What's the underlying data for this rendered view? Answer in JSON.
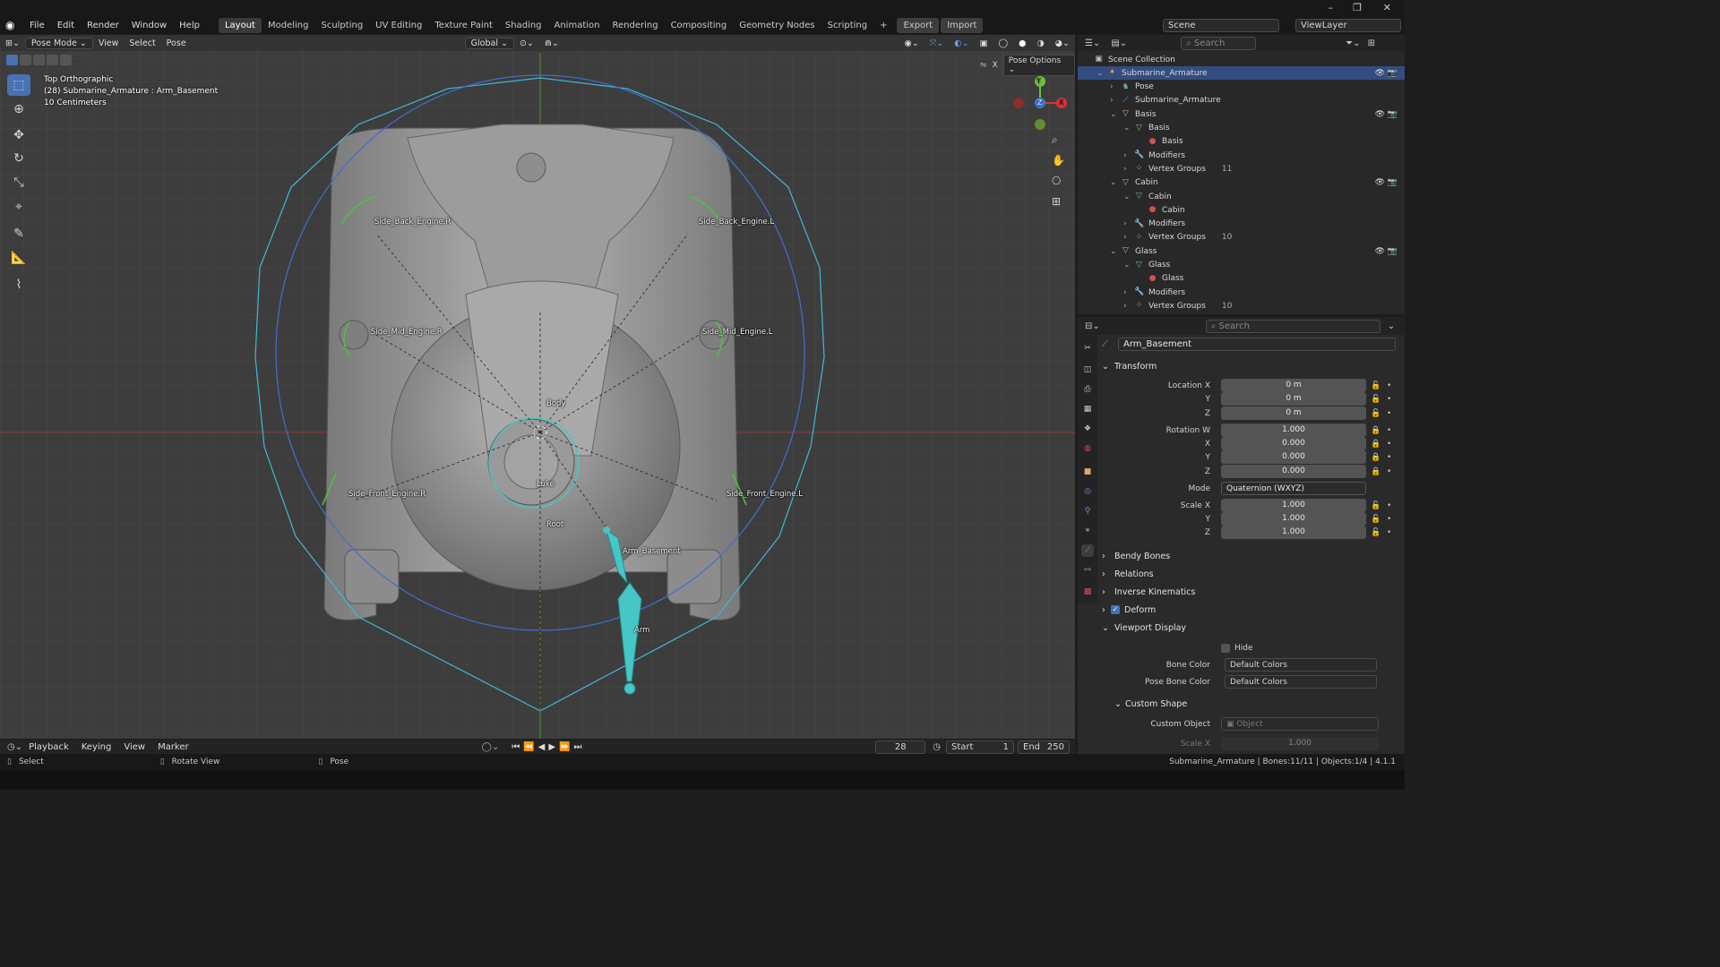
{
  "topbar": {
    "minimize": "–",
    "maximize": "❐",
    "close": "✕"
  },
  "menubar": {
    "menus": [
      "File",
      "Edit",
      "Render",
      "Window",
      "Help"
    ],
    "workspaces": [
      "Layout",
      "Modeling",
      "Sculpting",
      "UV Editing",
      "Texture Paint",
      "Shading",
      "Animation",
      "Rendering",
      "Compositing",
      "Geometry Nodes",
      "Scripting"
    ],
    "active_workspace": "Layout",
    "add_ws": "+",
    "export": "Export",
    "import": "Import",
    "scene": "Scene",
    "view_layer": "ViewLayer"
  },
  "viewport_header": {
    "mode": "Pose Mode",
    "menus": [
      "View",
      "Select",
      "Pose"
    ],
    "orientation": "Global",
    "pose_options": "Pose Options",
    "x_label": "X"
  },
  "viewport": {
    "view_name": "Top Orthographic",
    "object_info": "(28) Submarine_Armature : Arm_Basement",
    "scale_info": "10 Centimeters",
    "gizmo": {
      "y": "Y",
      "z": "Z",
      "x": "X"
    },
    "bones": [
      "Side_Back_Engine.R",
      "Side_Back_Engine.L",
      "Side_Mid_Engine.R",
      "Side_Mid_Engine.L",
      "Body",
      "Luke",
      "Side_Front_Engine.R",
      "Side_Front_Engine.L",
      "Root",
      "Arm_Basement",
      "Arm"
    ]
  },
  "outliner": {
    "search_placeholder": "Search",
    "rows": [
      {
        "label": "Scene Collection",
        "indent": 0,
        "icon": "collection-icon",
        "color": "#bdbdbd"
      },
      {
        "label": "Submarine_Armature",
        "indent": 1,
        "icon": "armature-icon",
        "color": "#e1a46b",
        "selected": true,
        "eye": true
      },
      {
        "label": "Pose",
        "indent": 2,
        "icon": "pose-icon",
        "color": "#6ea9a0"
      },
      {
        "label": "Submarine_Armature",
        "indent": 2,
        "icon": "armature-data-icon",
        "color": "#6ea9a0"
      },
      {
        "label": "Basis",
        "indent": 2,
        "icon": "mesh-object-icon",
        "color": "#e1a46b",
        "eye": true
      },
      {
        "label": "Basis",
        "indent": 3,
        "icon": "mesh-data-icon",
        "color": "#6ec17e"
      },
      {
        "label": "Basis",
        "indent": 4,
        "icon": "material-icon",
        "color": "#d05050"
      },
      {
        "label": "Modifiers",
        "indent": 3,
        "icon": "wrench-icon",
        "color": "#6c8fd3"
      },
      {
        "label": "Vertex Groups",
        "indent": 3,
        "icon": "vertex-groups-icon",
        "color": "#cfcfcf"
      },
      {
        "label": "Cabin",
        "indent": 2,
        "icon": "mesh-object-icon",
        "color": "#e1a46b",
        "eye": true
      },
      {
        "label": "Cabin",
        "indent": 3,
        "icon": "mesh-data-icon",
        "color": "#6ec17e"
      },
      {
        "label": "Cabin",
        "indent": 4,
        "icon": "material-icon",
        "color": "#d05050"
      },
      {
        "label": "Modifiers",
        "indent": 3,
        "icon": "wrench-icon",
        "color": "#6c8fd3"
      },
      {
        "label": "Vertex Groups",
        "indent": 3,
        "icon": "vertex-groups-icon",
        "color": "#cfcfcf"
      },
      {
        "label": "Glass",
        "indent": 2,
        "icon": "mesh-object-icon",
        "color": "#e1a46b",
        "eye": true
      },
      {
        "label": "Glass",
        "indent": 3,
        "icon": "mesh-data-icon",
        "color": "#6ec17e"
      },
      {
        "label": "Glass",
        "indent": 4,
        "icon": "material-icon",
        "color": "#d05050"
      },
      {
        "label": "Modifiers",
        "indent": 3,
        "icon": "wrench-icon",
        "color": "#6c8fd3"
      },
      {
        "label": "Vertex Groups",
        "indent": 3,
        "icon": "vertex-groups-icon",
        "color": "#cfcfcf"
      }
    ],
    "vg_badges": [
      "11",
      "10",
      "10"
    ]
  },
  "properties": {
    "search_placeholder": "Search",
    "bone_name": "Arm_Basement",
    "transform_title": "Transform",
    "location": {
      "x_label": "Location X",
      "y_label": "Y",
      "z_label": "Z",
      "x": "0 m",
      "y": "0 m",
      "z": "0 m"
    },
    "rotation": {
      "w_label": "Rotation W",
      "x_label": "X",
      "y_label": "Y",
      "z_label": "Z",
      "w": "1.000",
      "x": "0.000",
      "y": "0.000",
      "z": "0.000"
    },
    "mode_label": "Mode",
    "mode_value": "Quaternion (WXYZ)",
    "scale": {
      "x_label": "Scale X",
      "y_label": "Y",
      "z_label": "Z",
      "x": "1.000",
      "y": "1.000",
      "z": "1.000"
    },
    "sections": [
      "Bendy Bones",
      "Relations",
      "Inverse Kinematics"
    ],
    "deform": "Deform",
    "viewport_display": "Viewport Display",
    "hide_label": "Hide",
    "bone_color_label": "Bone Color",
    "bone_color_value": "Default Colors",
    "pose_bone_color_label": "Pose Bone Color",
    "pose_bone_color_value": "Default Colors",
    "custom_shape": "Custom Shape",
    "custom_object_label": "Custom Object",
    "custom_object_placeholder": "Object",
    "cs_scale_label": "Scale X",
    "cs_scale_value": "1.000"
  },
  "timeline": {
    "menus": [
      "Playback",
      "Keying",
      "View",
      "Marker"
    ],
    "frame": "28",
    "start_label": "Start",
    "start": "1",
    "end_label": "End",
    "end": "250"
  },
  "statusbar": {
    "select": "Select",
    "rotate_view": "Rotate View",
    "pose": "Pose",
    "info": "Submarine_Armature | Bones:11/11 | Objects:1/4 | 4.1.1"
  },
  "colors": {
    "accent": "#4772b3",
    "selection": "#334d80",
    "bone_teal": "#46c6c6",
    "circle_blue": "#3f6fd1",
    "circle_cyan": "#3fb8d8"
  }
}
